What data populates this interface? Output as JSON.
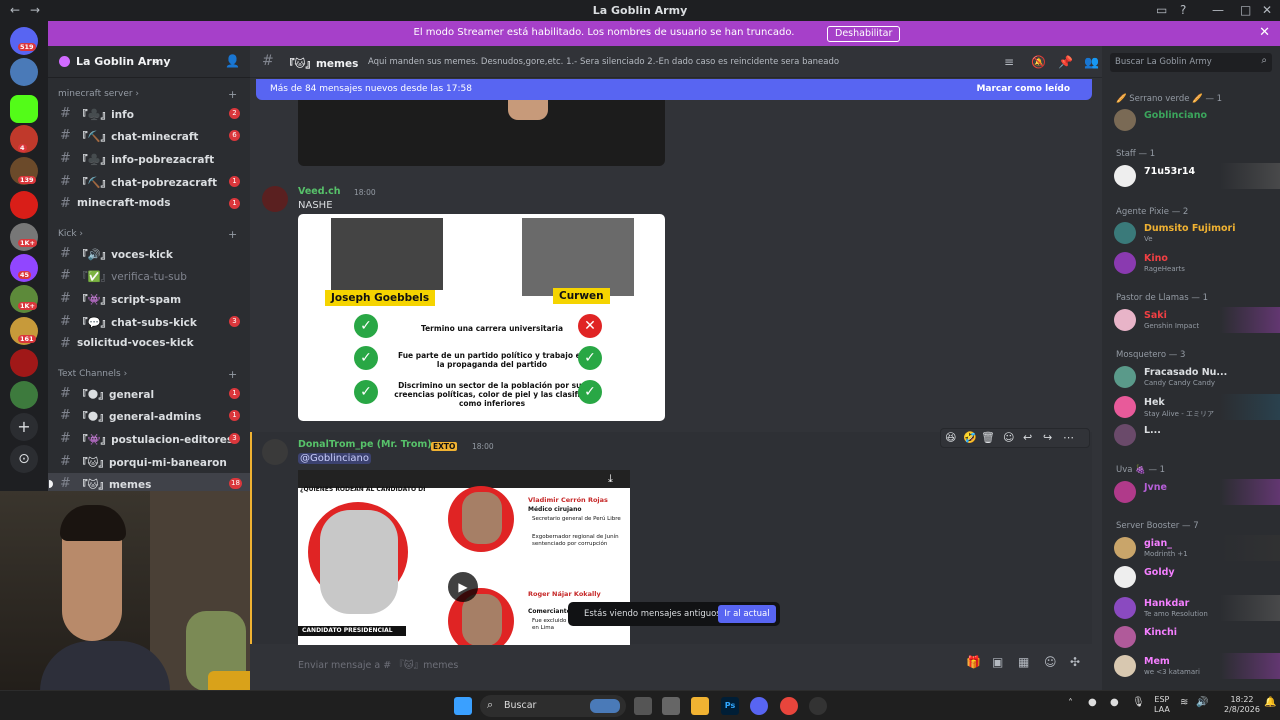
{
  "window": {
    "title": "La Goblin Army"
  },
  "banner": {
    "message": "El modo Streamer está habilitado. Los nombres de usuario se han truncado.",
    "button": "Deshabilitar"
  },
  "guild_badges": [
    "519",
    "4",
    "139",
    "1K+",
    "45",
    "1K+",
    "161"
  ],
  "server": {
    "name": "La Goblin Army"
  },
  "categories": [
    {
      "name": "minecraft server",
      "channels": [
        {
          "label": "『♣️』info",
          "badge": "2"
        },
        {
          "label": "『⛏️』chat-minecraft",
          "badge": "6"
        },
        {
          "label": "『♣️』info-pobrezacraft",
          "badge": ""
        },
        {
          "label": "『⛏️』chat-pobrezacraft",
          "badge": "1"
        },
        {
          "label": "minecraft-mods",
          "badge": "1"
        }
      ]
    },
    {
      "name": "Kick",
      "channels": [
        {
          "label": "『🔊』voces-kick",
          "badge": ""
        },
        {
          "label": "『✅』verifica-tu-sub",
          "badge": ""
        },
        {
          "label": "『👾』script-spam",
          "badge": ""
        },
        {
          "label": "『💬』chat-subs-kick",
          "badge": "3"
        },
        {
          "label": "solicitud-voces-kick",
          "badge": ""
        }
      ]
    },
    {
      "name": "Text Channels",
      "channels": [
        {
          "label": "『🌑』general",
          "badge": "1"
        },
        {
          "label": "『🌑』general-admins",
          "badge": "1"
        },
        {
          "label": "『👾』postulacion-editores",
          "badge": "3"
        },
        {
          "label": "『🐱』porqui-mi-banearon",
          "badge": ""
        },
        {
          "label": "『🐱』memes",
          "badge": "18"
        }
      ]
    }
  ],
  "channel": {
    "name": "『🐱』memes",
    "topic": "Aqui manden sus memes. Desnudos,gore,etc. 1.- Sera silenciado 2.-En dado caso es reincidente sera baneado",
    "new_messages": "Más de 84 mensajes nuevos desde las 17:58",
    "mark_read": "Marcar como leído",
    "input_placeholder": "Enviar mensaje a # 『🐱』memes"
  },
  "messages": [
    {
      "author": "Veed.ch",
      "time": "18:00",
      "text": "NASHE",
      "color": "#57c26a"
    },
    {
      "author": "DonalTrom_pe (Mr. Trom)",
      "tag": "EXTO",
      "time": "18:00",
      "mention": "@Goblinciano",
      "color": "#57c26a"
    }
  ],
  "meme_card": {
    "left_name": "Joseph Goebbels",
    "right_name": "Curwen",
    "rows": [
      "Termino una carrera universitaria",
      "Fue parte de un partido político y trabajo en la propaganda del partido",
      "Discrimino un sector de la población por sus creencias políticas, color de piel y las clasifico como inferiores"
    ]
  },
  "video": {
    "question": "¿QUIÉNES RODEAN AL CANDIDATO DE PERÚ LIBRE?",
    "person1_name": "Vladimir Cerrón Rojas",
    "person1_role": "Médico cirujano",
    "person1_facts": [
      "Secretario general de Perú Libre",
      "Exgobernador regional de Junín sentenciado por corrupción"
    ],
    "person2_name": "Roger Nájar Kokally",
    "person2_role": "Comerciante",
    "person2_fact": "Fue excluido de lista al Congreso en Lima",
    "candidate_label": "CANDIDATO PRESIDENCIAL"
  },
  "old_messages": {
    "text": "Estás viendo mensajes antiguos",
    "button": "Ir al actual"
  },
  "member_search": "Buscar La Goblin Army",
  "member_groups": [
    {
      "role": "🥖 Serrano verde 🥖 — 1",
      "members": [
        {
          "name": "Goblinciano",
          "status": "",
          "color": "#3ba55c"
        }
      ]
    },
    {
      "role": "Staff — 1",
      "members": [
        {
          "name": "71u53r14",
          "status": "",
          "color": "#ffffff"
        }
      ]
    },
    {
      "role": "Agente Pixie — 2",
      "members": [
        {
          "name": "Dumsito Fujimori",
          "status": "Ve",
          "color": "#f0b232"
        },
        {
          "name": "Kino",
          "status": "RageHearts",
          "color": "#f23f43"
        }
      ]
    },
    {
      "role": "Pastor de Llamas — 1",
      "members": [
        {
          "name": "Saki",
          "status": "Genshin Impact",
          "color": "#f23f43"
        }
      ]
    },
    {
      "role": "Mosquetero — 3",
      "members": [
        {
          "name": "Fracasado Nu...",
          "status": "Candy Candy Candy",
          "color": "#dbdee1"
        },
        {
          "name": "Hek",
          "status": "Stay Alive - エミリア",
          "color": "#dbdee1"
        },
        {
          "name": "L...",
          "status": "",
          "color": "#dbdee1"
        }
      ]
    },
    {
      "role": "Uva 🍇 — 1",
      "members": [
        {
          "name": "Jvne",
          "status": "",
          "color": "#b65fd8"
        }
      ]
    },
    {
      "role": "Server Booster — 7",
      "members": [
        {
          "name": "gian_",
          "status": "Modrinth +1",
          "color": "#f47fff"
        },
        {
          "name": "Goldy",
          "status": "",
          "color": "#f47fff"
        },
        {
          "name": "Hankdar",
          "status": "Te amo Resolution",
          "color": "#f47fff"
        },
        {
          "name": "Kinchi",
          "status": "",
          "color": "#f47fff"
        },
        {
          "name": "Mem",
          "status": "we <3 katamari",
          "color": "#f47fff"
        }
      ]
    }
  ],
  "taskbar": {
    "search": "Buscar",
    "lang1": "ESP",
    "lang2": "LAA",
    "time": "18:22",
    "date": "2/8/2026"
  }
}
